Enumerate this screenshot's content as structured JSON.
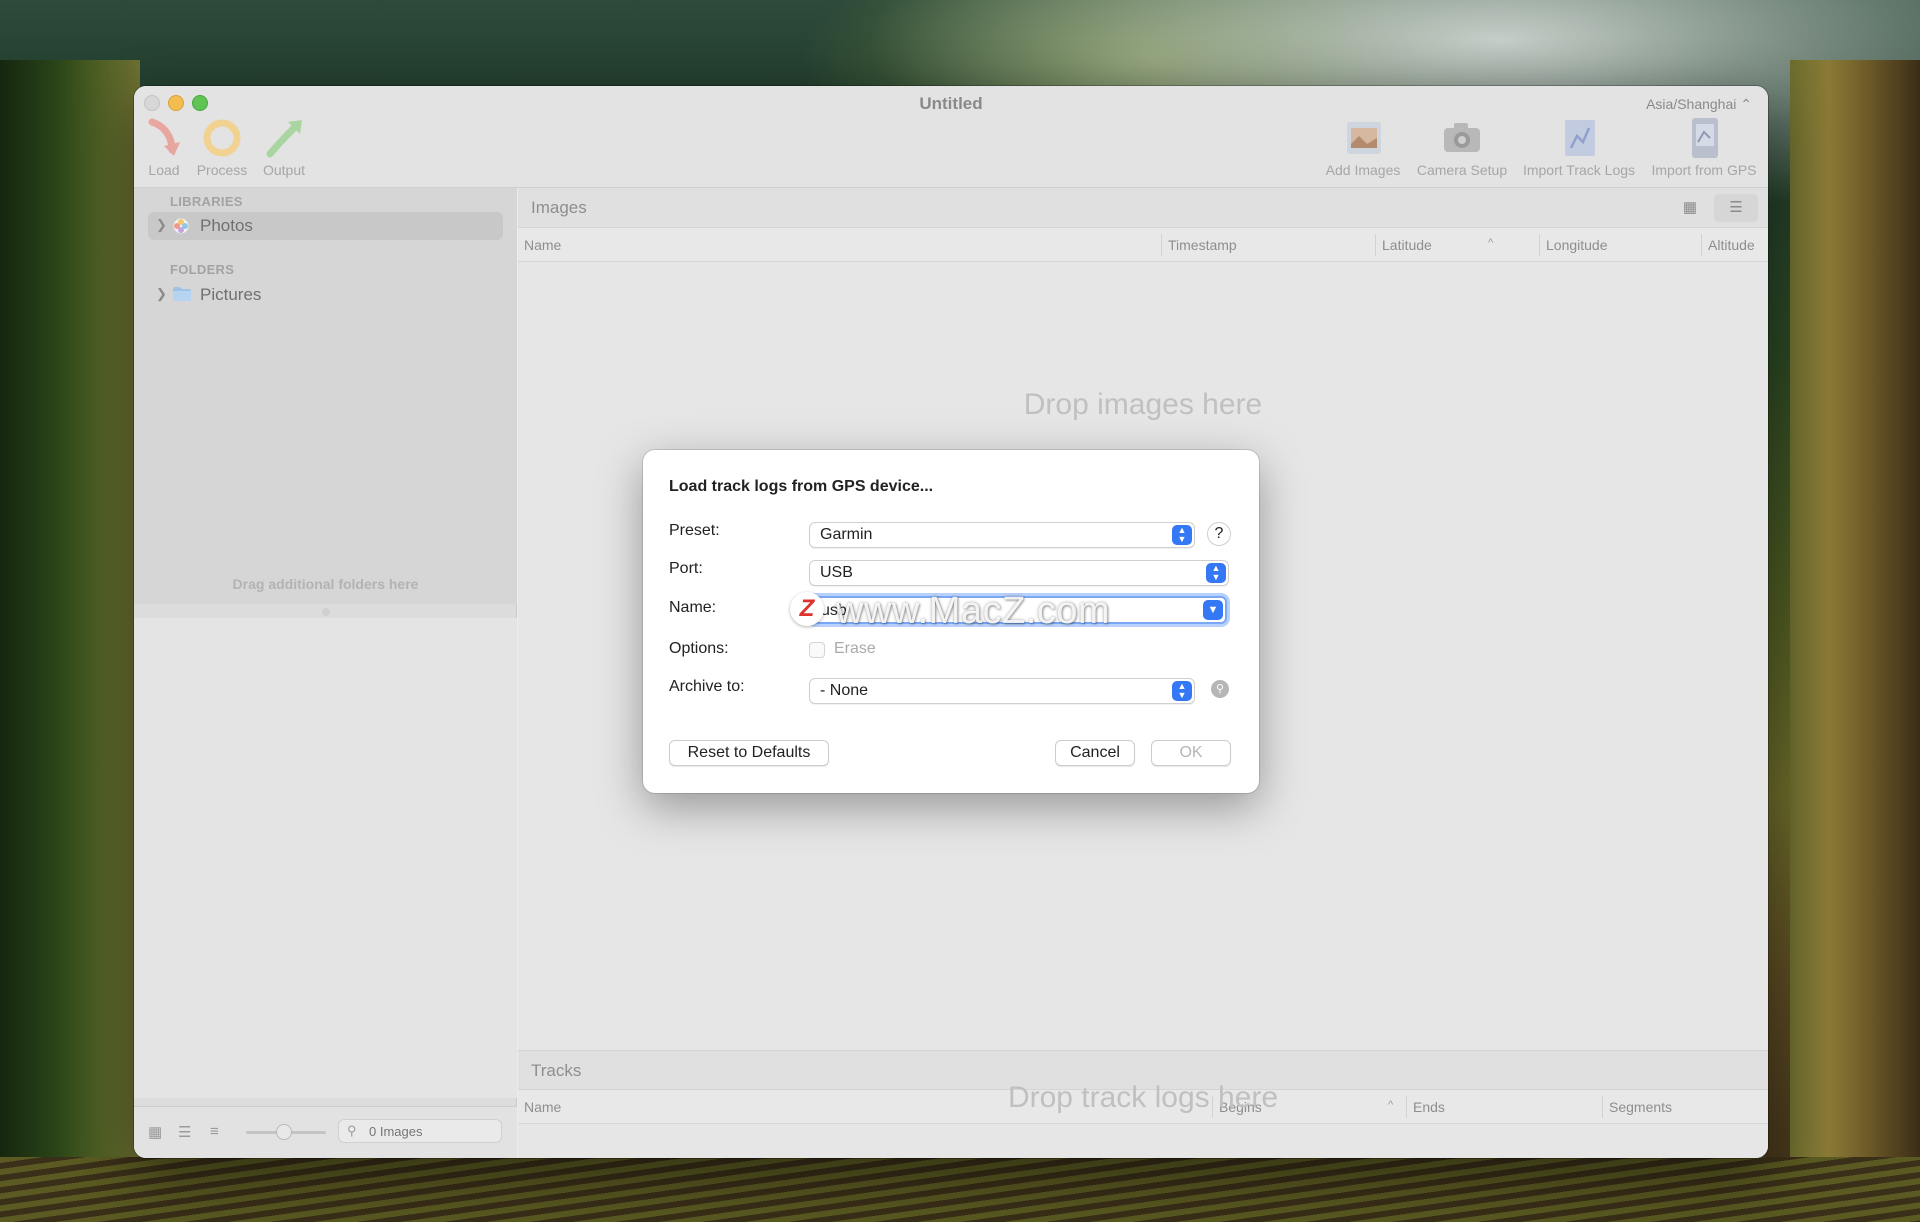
{
  "window": {
    "title": "Untitled",
    "timezone": "Asia/Shanghai ⌃"
  },
  "toolbar": {
    "left": [
      {
        "label": "Load",
        "icon": "load-icon"
      },
      {
        "label": "Process",
        "icon": "process-icon"
      },
      {
        "label": "Output",
        "icon": "output-icon"
      }
    ],
    "right": [
      {
        "label": "Add Images",
        "icon": "add-images-icon"
      },
      {
        "label": "Camera Setup",
        "icon": "camera-icon"
      },
      {
        "label": "Import Track Logs",
        "icon": "import-track-logs-icon"
      },
      {
        "label": "Import from GPS",
        "icon": "import-from-gps-icon"
      }
    ]
  },
  "sidebar": {
    "libraries_header": "LIBRARIES",
    "libraries": [
      {
        "label": "Photos",
        "icon": "photos-icon"
      }
    ],
    "folders_header": "FOLDERS",
    "folders": [
      {
        "label": "Pictures",
        "icon": "folder-icon"
      }
    ],
    "drag_hint": "Drag additional folders here",
    "search_placeholder": "0 Images"
  },
  "images_pane": {
    "title": "Images",
    "columns": [
      "Name",
      "Timestamp",
      "Latitude",
      "Longitude",
      "Altitude"
    ],
    "sort_indicator": "^",
    "empty_text": "Drop images here"
  },
  "tracks_pane": {
    "title": "Tracks",
    "columns": [
      "Name",
      "Begins",
      "Ends",
      "Segments"
    ],
    "sort_indicator": "^",
    "empty_text": "Drop track logs here"
  },
  "dialog": {
    "title": "Load track logs from GPS device...",
    "preset_label": "Preset:",
    "preset_value": "Garmin",
    "help_label": "?",
    "port_label": "Port:",
    "port_value": "USB",
    "name_label": "Name:",
    "name_value": "usb",
    "options_label": "Options:",
    "erase_label": "Erase",
    "erase_checked": false,
    "archive_label": "Archive to:",
    "archive_value": "- None",
    "reset_button": "Reset to Defaults",
    "cancel_button": "Cancel",
    "ok_button": "OK"
  },
  "watermark": {
    "logo_letter": "Z",
    "text": "www.MacZ.com"
  },
  "colors": {
    "accent": "#3478f6",
    "traffic_minimize": "#f4bd4f",
    "traffic_maximize": "#5fc454"
  }
}
